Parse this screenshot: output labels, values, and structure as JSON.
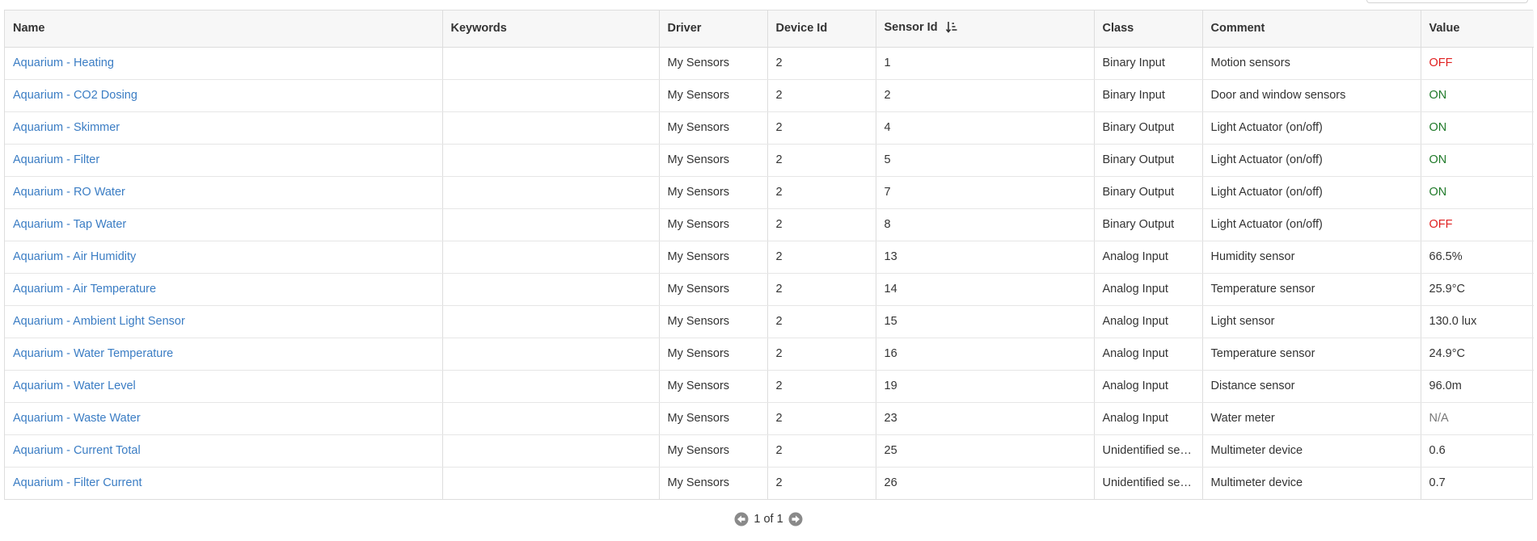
{
  "columns": {
    "name": "Name",
    "keywords": "Keywords",
    "driver": "Driver",
    "device_id": "Device Id",
    "sensor_id": "Sensor Id",
    "class": "Class",
    "comment": "Comment",
    "value": "Value"
  },
  "sort": {
    "column": "Sensor Id",
    "direction": "ascending"
  },
  "rows": [
    {
      "name": "Aquarium - Heating",
      "keywords": "",
      "driver": "My Sensors",
      "device_id": "2",
      "sensor_id": "1",
      "class": "Binary Input",
      "comment": "Motion sensors",
      "value": "OFF",
      "value_state": "off"
    },
    {
      "name": "Aquarium - CO2 Dosing",
      "keywords": "",
      "driver": "My Sensors",
      "device_id": "2",
      "sensor_id": "2",
      "class": "Binary Input",
      "comment": "Door and window sensors",
      "value": "ON",
      "value_state": "on"
    },
    {
      "name": "Aquarium - Skimmer",
      "keywords": "",
      "driver": "My Sensors",
      "device_id": "2",
      "sensor_id": "4",
      "class": "Binary Output",
      "comment": "Light Actuator (on/off)",
      "value": "ON",
      "value_state": "on"
    },
    {
      "name": "Aquarium - Filter",
      "keywords": "",
      "driver": "My Sensors",
      "device_id": "2",
      "sensor_id": "5",
      "class": "Binary Output",
      "comment": "Light Actuator (on/off)",
      "value": "ON",
      "value_state": "on"
    },
    {
      "name": "Aquarium - RO Water",
      "keywords": "",
      "driver": "My Sensors",
      "device_id": "2",
      "sensor_id": "7",
      "class": "Binary Output",
      "comment": "Light Actuator (on/off)",
      "value": "ON",
      "value_state": "on"
    },
    {
      "name": "Aquarium - Tap Water",
      "keywords": "",
      "driver": "My Sensors",
      "device_id": "2",
      "sensor_id": "8",
      "class": "Binary Output",
      "comment": "Light Actuator (on/off)",
      "value": "OFF",
      "value_state": "off"
    },
    {
      "name": "Aquarium - Air Humidity",
      "keywords": "",
      "driver": "My Sensors",
      "device_id": "2",
      "sensor_id": "13",
      "class": "Analog Input",
      "comment": "Humidity sensor",
      "value": "66.5%",
      "value_state": "normal"
    },
    {
      "name": "Aquarium - Air Temperature",
      "keywords": "",
      "driver": "My Sensors",
      "device_id": "2",
      "sensor_id": "14",
      "class": "Analog Input",
      "comment": "Temperature sensor",
      "value": "25.9°C",
      "value_state": "normal"
    },
    {
      "name": "Aquarium - Ambient Light Sensor",
      "keywords": "",
      "driver": "My Sensors",
      "device_id": "2",
      "sensor_id": "15",
      "class": "Analog Input",
      "comment": "Light sensor",
      "value": "130.0 lux",
      "value_state": "normal"
    },
    {
      "name": "Aquarium - Water Temperature",
      "keywords": "",
      "driver": "My Sensors",
      "device_id": "2",
      "sensor_id": "16",
      "class": "Analog Input",
      "comment": "Temperature sensor",
      "value": "24.9°C",
      "value_state": "normal"
    },
    {
      "name": "Aquarium - Water Level",
      "keywords": "",
      "driver": "My Sensors",
      "device_id": "2",
      "sensor_id": "19",
      "class": "Analog Input",
      "comment": "Distance sensor",
      "value": "96.0m",
      "value_state": "normal"
    },
    {
      "name": "Aquarium - Waste Water",
      "keywords": "",
      "driver": "My Sensors",
      "device_id": "2",
      "sensor_id": "23",
      "class": "Analog Input",
      "comment": "Water meter",
      "value": "N/A",
      "value_state": "na"
    },
    {
      "name": "Aquarium - Current Total",
      "keywords": "",
      "driver": "My Sensors",
      "device_id": "2",
      "sensor_id": "25",
      "class": "Unidentified sen...",
      "comment": "Multimeter device",
      "value": "0.6",
      "value_state": "normal"
    },
    {
      "name": "Aquarium - Filter Current",
      "keywords": "",
      "driver": "My Sensors",
      "device_id": "2",
      "sensor_id": "26",
      "class": "Unidentified sen...",
      "comment": "Multimeter device",
      "value": "0.7",
      "value_state": "normal"
    }
  ],
  "pagination": {
    "text": "1 of 1",
    "prev_icon": "arrow-circle-left-icon",
    "next_icon": "arrow-circle-right-icon"
  },
  "colors": {
    "link": "#3b7dc4",
    "off": "#e02020",
    "on": "#207a2a",
    "na": "#777777",
    "border": "#dddddd"
  }
}
